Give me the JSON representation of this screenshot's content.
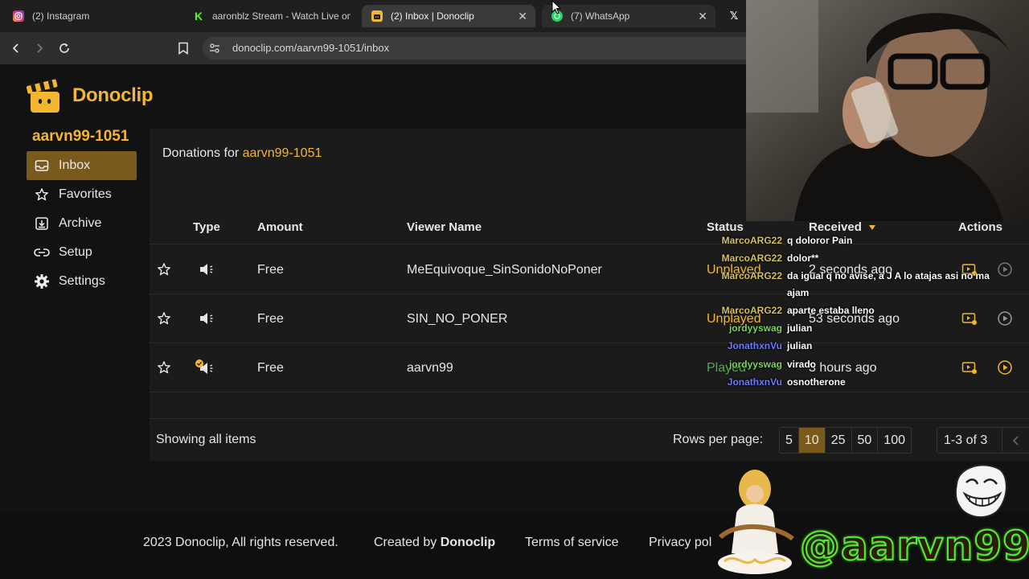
{
  "browser": {
    "tabs": [
      {
        "title": "(2) Instagram",
        "icon": "instagram-icon",
        "active": false
      },
      {
        "title": "aaronblz Stream - Watch Live on",
        "icon": "kick-icon",
        "active": false
      },
      {
        "title": "(2) Inbox | Donoclip",
        "icon": "donoclip-icon",
        "active": true
      },
      {
        "title": "(7) WhatsApp",
        "icon": "whatsapp-icon",
        "active": false
      },
      {
        "title": "",
        "icon": "x-icon",
        "active": false
      }
    ],
    "url": "donoclip.com/aarvn99-1051/inbox"
  },
  "brand": {
    "name": "Donoclip",
    "accent": "#f2b630"
  },
  "sidebar": {
    "username": "aarvn99-1051",
    "items": [
      {
        "label": "Inbox",
        "icon": "inbox-icon",
        "active": true
      },
      {
        "label": "Favorites",
        "icon": "star-icon",
        "active": false
      },
      {
        "label": "Archive",
        "icon": "archive-icon",
        "active": false
      },
      {
        "label": "Setup",
        "icon": "link-icon",
        "active": false
      },
      {
        "label": "Settings",
        "icon": "gear-icon",
        "active": false
      }
    ]
  },
  "main": {
    "header_prefix": "Donations for",
    "header_user": "aarvn99-1051",
    "columns": {
      "type": "Type",
      "amount": "Amount",
      "viewer": "Viewer Name",
      "status": "Status",
      "received": "Received",
      "actions": "Actions"
    },
    "rows": [
      {
        "amount": "Free",
        "viewer": "MeEquivoque_SinSonidoNoPoner",
        "status": "Unplayed",
        "received": "2 seconds ago"
      },
      {
        "amount": "Free",
        "viewer": "SIN_NO_PONER",
        "status": "Unplayed",
        "received": "53 seconds ago"
      },
      {
        "amount": "Free",
        "viewer": "aarvn99",
        "status": "Played",
        "received": "3 hours ago"
      }
    ],
    "showing": "Showing all items",
    "rows_per_page_label": "Rows per page:",
    "rows_per_page_options": [
      "5",
      "10",
      "25",
      "50",
      "100"
    ],
    "rows_per_page_selected": "10",
    "range": "1-3 of 3"
  },
  "footer": {
    "copyright": "2023 Donoclip, All rights reserved.",
    "created_prefix": "Created by",
    "created_brand": "Donoclip",
    "terms": "Terms of service",
    "privacy": "Privacy pol"
  },
  "stream_overlay": {
    "chat": [
      {
        "user": "MarcoARG22",
        "message": "q doloror Pain",
        "color": "#d6c15a"
      },
      {
        "user": "MarcoARG22",
        "message": "dolor**",
        "color": "#d6c15a"
      },
      {
        "user": "MarcoARG22",
        "message": "da igual q no avise, a J A lo atajas asi no ma",
        "color": "#d6c15a"
      },
      {
        "user": "",
        "message": "ajam",
        "color": "#d6c15a"
      },
      {
        "user": "MarcoARG22",
        "message": "aparte estaba lleno",
        "color": "#d6c15a"
      },
      {
        "user": "jordyyswag",
        "message": "julian",
        "color": "#7cd35a"
      },
      {
        "user": "JonathxnVu",
        "message": "julian",
        "color": "#6b7bff"
      },
      {
        "user": "jordyyswag",
        "message": "virado",
        "color": "#7cd35a"
      },
      {
        "user": "JonathxnVu",
        "message": "osnotherone",
        "color": "#6b7bff"
      }
    ],
    "handle": "@aarvn99"
  }
}
